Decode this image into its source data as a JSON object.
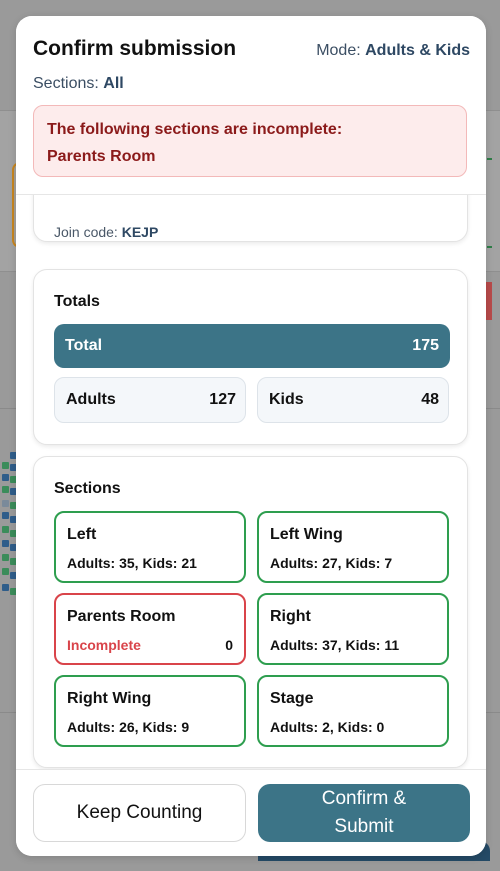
{
  "modal": {
    "title": "Confirm submission",
    "mode_label": "Mode:",
    "mode_value": "Adults & Kids",
    "sections_label": "Sections:",
    "sections_value": "All"
  },
  "alert": {
    "title": "The following sections are incomplete:",
    "items": [
      "Parents Room"
    ]
  },
  "info": {
    "join_label": "Join code:",
    "join_value": "KEJP"
  },
  "totals": {
    "title": "Totals",
    "total_label": "Total",
    "total_value": "175",
    "adults_label": "Adults",
    "adults_value": "127",
    "kids_label": "Kids",
    "kids_value": "48"
  },
  "sections": {
    "title": "Sections",
    "items": [
      {
        "name": "Left",
        "counts": "Adults: 35, Kids: 21"
      },
      {
        "name": "Left Wing",
        "counts": "Adults: 27, Kids: 7"
      },
      {
        "name": "Parents Room",
        "status": "Incomplete",
        "total": "0"
      },
      {
        "name": "Right",
        "counts": "Adults: 37, Kids: 11"
      },
      {
        "name": "Right Wing",
        "counts": "Adults: 26, Kids: 9"
      },
      {
        "name": "Stage",
        "counts": "Adults: 2, Kids: 0"
      }
    ]
  },
  "footer": {
    "keep_label": "Keep Counting",
    "confirm_label": "Confirm & Submit"
  },
  "colors": {
    "accent": "#3c7487",
    "complete_border": "#2e9e4f",
    "incomplete_border": "#d9444a",
    "alert_bg": "#fdecec",
    "alert_text": "#8b1a1a"
  }
}
